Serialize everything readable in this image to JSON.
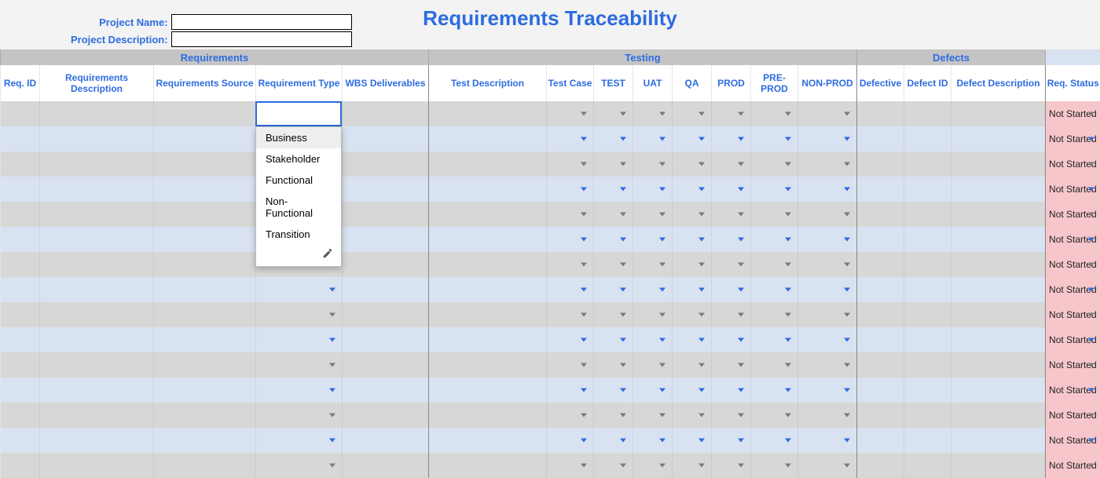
{
  "title": "Requirements Traceability",
  "project": {
    "name_label": "Project Name:",
    "desc_label": "Project Description:",
    "name_value": "",
    "desc_value": ""
  },
  "groups": {
    "req": "Requirements",
    "test": "Testing",
    "def": "Defects"
  },
  "columns": {
    "req_id": "Req. ID",
    "req_desc": "Requirements Description",
    "req_src": "Requirements Source",
    "req_type": "Requirement Type",
    "wbs": "WBS Deliverables",
    "test_desc": "Test Description",
    "test_case": "Test Case",
    "test": "TEST",
    "uat": "UAT",
    "qa": "QA",
    "prod": "PROD",
    "preprod": "PRE-PROD",
    "nonprod": "NON-PROD",
    "defective": "Defective",
    "defect_id": "Defect ID",
    "defect_desc": "Defect Description",
    "req_status": "Req. Status"
  },
  "status_default": "Not Started",
  "type_options": [
    "Business",
    "Stakeholder",
    "Functional",
    "Non-Functional",
    "Transition"
  ],
  "row_count": 15,
  "col_widths": {
    "req_id": 50,
    "req_desc": 145,
    "req_src": 130,
    "req_type": 110,
    "wbs": 110,
    "test_desc": 150,
    "test_case": 60,
    "test": 50,
    "uat": 50,
    "qa": 50,
    "prod": 50,
    "preprod": 60,
    "nonprod": 75,
    "defective": 60,
    "defect_id": 60,
    "defect_desc": 120,
    "req_status": 70
  }
}
